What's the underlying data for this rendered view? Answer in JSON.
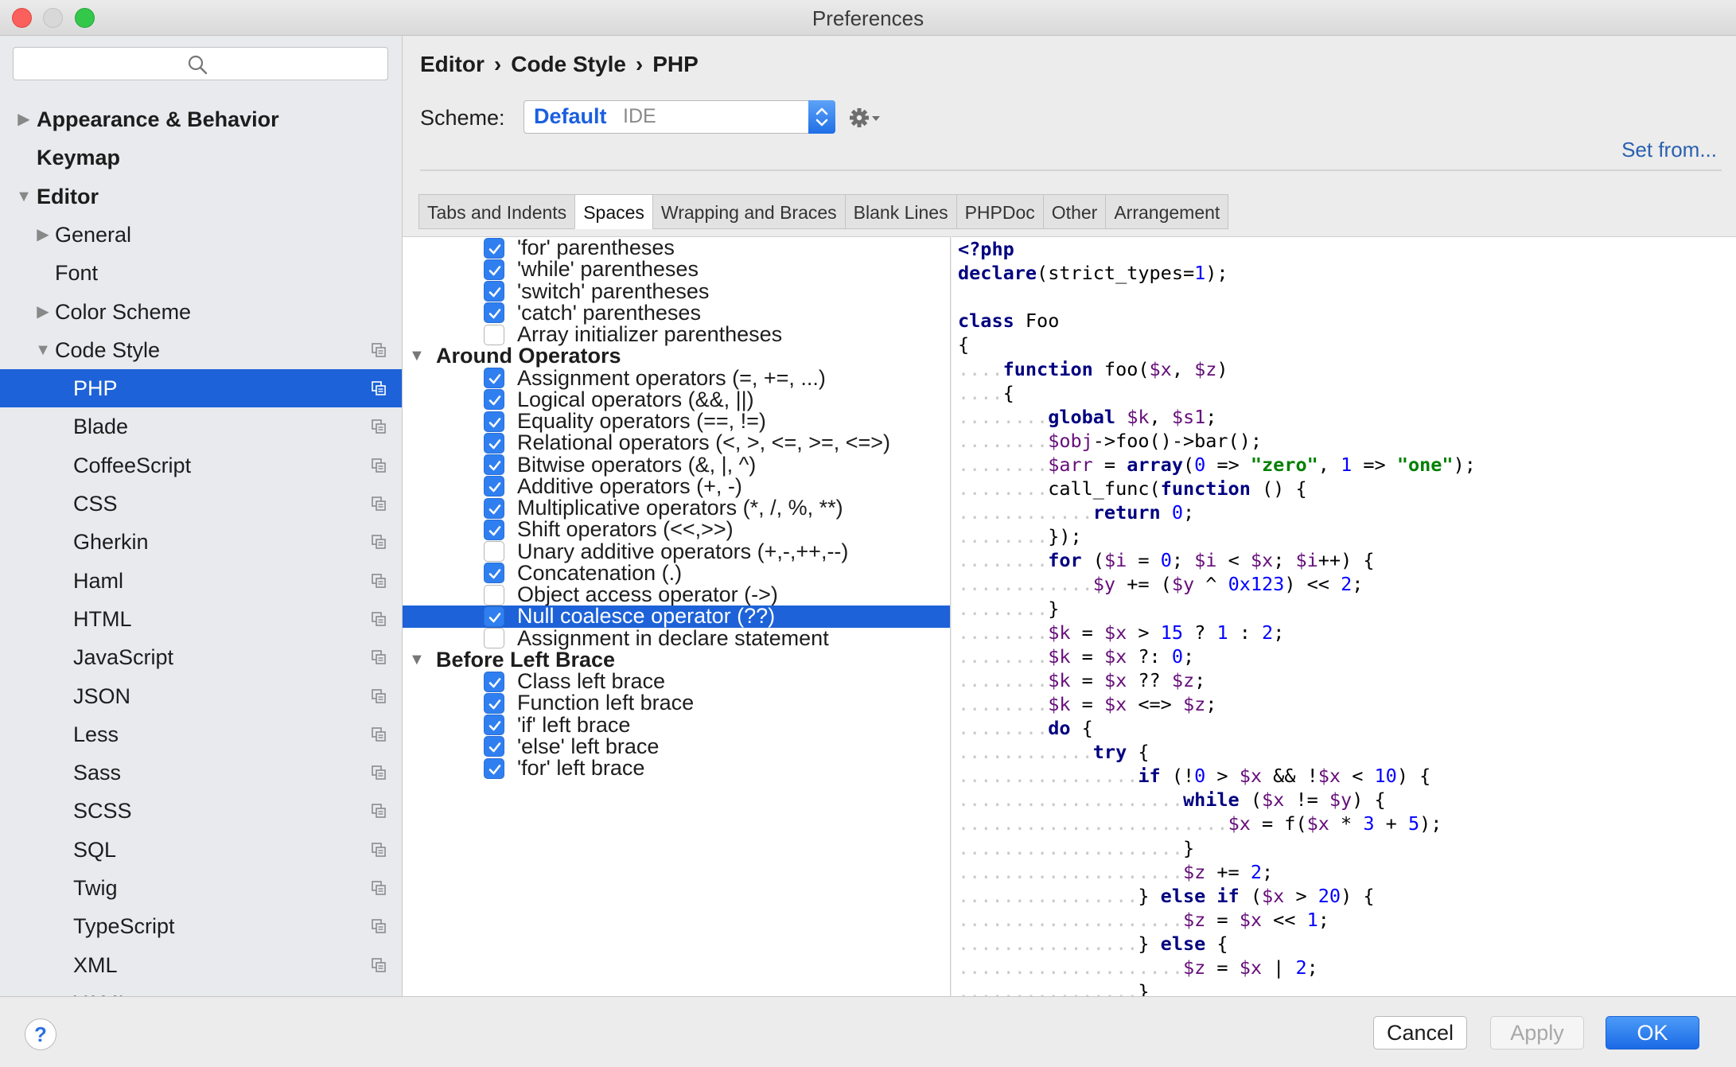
{
  "window": {
    "title": "Preferences"
  },
  "sidebar": {
    "search_placeholder": "",
    "items": [
      {
        "label": "Appearance & Behavior",
        "bold": true,
        "arrow": "right",
        "level": 0
      },
      {
        "label": "Keymap",
        "bold": true,
        "arrow": "",
        "level": 0
      },
      {
        "label": "Editor",
        "bold": true,
        "arrow": "down",
        "level": 0
      },
      {
        "label": "General",
        "bold": false,
        "arrow": "right",
        "level": 1
      },
      {
        "label": "Font",
        "bold": false,
        "arrow": "",
        "level": 1
      },
      {
        "label": "Color Scheme",
        "bold": false,
        "arrow": "right",
        "level": 1
      },
      {
        "label": "Code Style",
        "bold": false,
        "arrow": "down",
        "level": 1,
        "copy": true
      },
      {
        "label": "PHP",
        "bold": false,
        "arrow": "",
        "level": 2,
        "copy": true,
        "selected": true
      },
      {
        "label": "Blade",
        "level": 2,
        "copy": true
      },
      {
        "label": "CoffeeScript",
        "level": 2,
        "copy": true
      },
      {
        "label": "CSS",
        "level": 2,
        "copy": true
      },
      {
        "label": "Gherkin",
        "level": 2,
        "copy": true
      },
      {
        "label": "Haml",
        "level": 2,
        "copy": true
      },
      {
        "label": "HTML",
        "level": 2,
        "copy": true
      },
      {
        "label": "JavaScript",
        "level": 2,
        "copy": true
      },
      {
        "label": "JSON",
        "level": 2,
        "copy": true
      },
      {
        "label": "Less",
        "level": 2,
        "copy": true
      },
      {
        "label": "Sass",
        "level": 2,
        "copy": true
      },
      {
        "label": "SCSS",
        "level": 2,
        "copy": true
      },
      {
        "label": "SQL",
        "level": 2,
        "copy": true
      },
      {
        "label": "Twig",
        "level": 2,
        "copy": true
      },
      {
        "label": "TypeScript",
        "level": 2,
        "copy": true
      },
      {
        "label": "XML",
        "level": 2,
        "copy": true
      },
      {
        "label": "YAML",
        "level": 2,
        "copy": true
      }
    ]
  },
  "header": {
    "breadcrumb": [
      "Editor",
      "Code Style",
      "PHP"
    ],
    "breadcrumb_sep": "›",
    "scheme_label": "Scheme:",
    "scheme_name": "Default",
    "scheme_sub": "IDE",
    "set_from": "Set from..."
  },
  "tabs": [
    {
      "label": "Tabs and Indents",
      "active": false
    },
    {
      "label": "Spaces",
      "active": true
    },
    {
      "label": "Wrapping and Braces",
      "active": false
    },
    {
      "label": "Blank Lines",
      "active": false
    },
    {
      "label": "PHPDoc",
      "active": false
    },
    {
      "label": "Other",
      "active": false
    },
    {
      "label": "Arrangement",
      "active": false
    }
  ],
  "options": [
    {
      "type": "check",
      "label": "'for' parentheses",
      "checked": true
    },
    {
      "type": "check",
      "label": "'while' parentheses",
      "checked": true
    },
    {
      "type": "check",
      "label": "'switch' parentheses",
      "checked": true
    },
    {
      "type": "check",
      "label": "'catch' parentheses",
      "checked": true
    },
    {
      "type": "check",
      "label": "Array initializer parentheses",
      "checked": false
    },
    {
      "type": "group",
      "label": "Around Operators"
    },
    {
      "type": "check",
      "label": "Assignment operators (=, +=, ...)",
      "checked": true
    },
    {
      "type": "check",
      "label": "Logical operators (&&, ||)",
      "checked": true
    },
    {
      "type": "check",
      "label": "Equality operators (==, !=)",
      "checked": true
    },
    {
      "type": "check",
      "label": "Relational operators (<, >, <=, >=, <=>)",
      "checked": true
    },
    {
      "type": "check",
      "label": "Bitwise operators (&, |, ^)",
      "checked": true
    },
    {
      "type": "check",
      "label": "Additive operators (+, -)",
      "checked": true
    },
    {
      "type": "check",
      "label": "Multiplicative operators (*, /, %, **)",
      "checked": true
    },
    {
      "type": "check",
      "label": "Shift operators (<<,>>)",
      "checked": true
    },
    {
      "type": "check",
      "label": "Unary additive operators (+,-,++,--)",
      "checked": false
    },
    {
      "type": "check",
      "label": "Concatenation (.)",
      "checked": true
    },
    {
      "type": "check",
      "label": "Object access operator (->)",
      "checked": false
    },
    {
      "type": "check",
      "label": "Null coalesce operator (??)",
      "checked": true,
      "selected": true
    },
    {
      "type": "check",
      "label": "Assignment in declare statement",
      "checked": false
    },
    {
      "type": "group",
      "label": "Before Left Brace"
    },
    {
      "type": "check",
      "label": "Class left brace",
      "checked": true
    },
    {
      "type": "check",
      "label": "Function left brace",
      "checked": true
    },
    {
      "type": "check",
      "label": "'if' left brace",
      "checked": true
    },
    {
      "type": "check",
      "label": "'else' left brace",
      "checked": true
    },
    {
      "type": "check",
      "label": "'for' left brace",
      "checked": true
    }
  ],
  "code_lines": [
    {
      "indent": 0,
      "tokens": [
        [
          "kw",
          "<?php"
        ]
      ]
    },
    {
      "indent": 0,
      "tokens": [
        [
          "kw",
          "declare"
        ],
        [
          "p",
          "(strict_types="
        ],
        [
          "num",
          "1"
        ],
        [
          "p",
          ");"
        ]
      ]
    },
    {
      "indent": 0,
      "tokens": []
    },
    {
      "indent": 0,
      "tokens": [
        [
          "kw",
          "class"
        ],
        [
          "p",
          " Foo"
        ]
      ]
    },
    {
      "indent": 0,
      "tokens": [
        [
          "p",
          "{"
        ]
      ]
    },
    {
      "indent": 1,
      "tokens": [
        [
          "kw",
          "function"
        ],
        [
          "p",
          " foo("
        ],
        [
          "var",
          "$x"
        ],
        [
          "p",
          ", "
        ],
        [
          "var",
          "$z"
        ],
        [
          "p",
          ")"
        ]
      ]
    },
    {
      "indent": 1,
      "tokens": [
        [
          "p",
          "{"
        ]
      ]
    },
    {
      "indent": 2,
      "tokens": [
        [
          "kw",
          "global"
        ],
        [
          "p",
          " "
        ],
        [
          "var",
          "$k"
        ],
        [
          "p",
          ", "
        ],
        [
          "var",
          "$s1"
        ],
        [
          "p",
          ";"
        ]
      ]
    },
    {
      "indent": 2,
      "tokens": [
        [
          "var",
          "$obj"
        ],
        [
          "p",
          "->foo()->bar();"
        ]
      ]
    },
    {
      "indent": 2,
      "tokens": [
        [
          "var",
          "$arr"
        ],
        [
          "p",
          " = "
        ],
        [
          "kw",
          "array"
        ],
        [
          "p",
          "("
        ],
        [
          "num",
          "0"
        ],
        [
          "p",
          " => "
        ],
        [
          "str",
          "\"zero\""
        ],
        [
          "p",
          ", "
        ],
        [
          "num",
          "1"
        ],
        [
          "p",
          " => "
        ],
        [
          "str",
          "\"one\""
        ],
        [
          "p",
          ");"
        ]
      ]
    },
    {
      "indent": 2,
      "tokens": [
        [
          "p",
          "call_func("
        ],
        [
          "kw",
          "function"
        ],
        [
          "p",
          " () {"
        ]
      ]
    },
    {
      "indent": 3,
      "tokens": [
        [
          "kw",
          "return"
        ],
        [
          "p",
          " "
        ],
        [
          "num",
          "0"
        ],
        [
          "p",
          ";"
        ]
      ]
    },
    {
      "indent": 2,
      "tokens": [
        [
          "p",
          "});"
        ]
      ]
    },
    {
      "indent": 2,
      "tokens": [
        [
          "kw",
          "for"
        ],
        [
          "p",
          " ("
        ],
        [
          "var",
          "$i"
        ],
        [
          "p",
          " = "
        ],
        [
          "num",
          "0"
        ],
        [
          "p",
          "; "
        ],
        [
          "var",
          "$i"
        ],
        [
          "p",
          " < "
        ],
        [
          "var",
          "$x"
        ],
        [
          "p",
          "; "
        ],
        [
          "var",
          "$i"
        ],
        [
          "p",
          "++) {"
        ]
      ]
    },
    {
      "indent": 3,
      "tokens": [
        [
          "var",
          "$y"
        ],
        [
          "p",
          " += ("
        ],
        [
          "var",
          "$y"
        ],
        [
          "p",
          " ^ "
        ],
        [
          "num",
          "0x123"
        ],
        [
          "p",
          ") << "
        ],
        [
          "num",
          "2"
        ],
        [
          "p",
          ";"
        ]
      ]
    },
    {
      "indent": 2,
      "tokens": [
        [
          "p",
          "}"
        ]
      ]
    },
    {
      "indent": 2,
      "tokens": [
        [
          "var",
          "$k"
        ],
        [
          "p",
          " = "
        ],
        [
          "var",
          "$x"
        ],
        [
          "p",
          " > "
        ],
        [
          "num",
          "15"
        ],
        [
          "p",
          " ? "
        ],
        [
          "num",
          "1"
        ],
        [
          "p",
          " : "
        ],
        [
          "num",
          "2"
        ],
        [
          "p",
          ";"
        ]
      ]
    },
    {
      "indent": 2,
      "tokens": [
        [
          "var",
          "$k"
        ],
        [
          "p",
          " = "
        ],
        [
          "var",
          "$x"
        ],
        [
          "p",
          " ?: "
        ],
        [
          "num",
          "0"
        ],
        [
          "p",
          ";"
        ]
      ]
    },
    {
      "indent": 2,
      "tokens": [
        [
          "var",
          "$k"
        ],
        [
          "p",
          " = "
        ],
        [
          "var",
          "$x"
        ],
        [
          "p",
          " ?? "
        ],
        [
          "var",
          "$z"
        ],
        [
          "p",
          ";"
        ]
      ]
    },
    {
      "indent": 2,
      "tokens": [
        [
          "var",
          "$k"
        ],
        [
          "p",
          " = "
        ],
        [
          "var",
          "$x"
        ],
        [
          "p",
          " <=> "
        ],
        [
          "var",
          "$z"
        ],
        [
          "p",
          ";"
        ]
      ]
    },
    {
      "indent": 2,
      "tokens": [
        [
          "kw",
          "do"
        ],
        [
          "p",
          " {"
        ]
      ]
    },
    {
      "indent": 3,
      "tokens": [
        [
          "kw",
          "try"
        ],
        [
          "p",
          " {"
        ]
      ]
    },
    {
      "indent": 4,
      "tokens": [
        [
          "kw",
          "if"
        ],
        [
          "p",
          " (!"
        ],
        [
          "num",
          "0"
        ],
        [
          "p",
          " > "
        ],
        [
          "var",
          "$x"
        ],
        [
          "p",
          " && !"
        ],
        [
          "var",
          "$x"
        ],
        [
          "p",
          " < "
        ],
        [
          "num",
          "10"
        ],
        [
          "p",
          ") {"
        ]
      ]
    },
    {
      "indent": 5,
      "tokens": [
        [
          "kw",
          "while"
        ],
        [
          "p",
          " ("
        ],
        [
          "var",
          "$x"
        ],
        [
          "p",
          " != "
        ],
        [
          "var",
          "$y"
        ],
        [
          "p",
          ") {"
        ]
      ]
    },
    {
      "indent": 6,
      "tokens": [
        [
          "var",
          "$x"
        ],
        [
          "p",
          " = f("
        ],
        [
          "var",
          "$x"
        ],
        [
          "p",
          " * "
        ],
        [
          "num",
          "3"
        ],
        [
          "p",
          " + "
        ],
        [
          "num",
          "5"
        ],
        [
          "p",
          ");"
        ]
      ]
    },
    {
      "indent": 5,
      "tokens": [
        [
          "p",
          "}"
        ]
      ]
    },
    {
      "indent": 5,
      "tokens": [
        [
          "var",
          "$z"
        ],
        [
          "p",
          " += "
        ],
        [
          "num",
          "2"
        ],
        [
          "p",
          ";"
        ]
      ]
    },
    {
      "indent": 4,
      "tokens": [
        [
          "p",
          "} "
        ],
        [
          "kw",
          "else if"
        ],
        [
          "p",
          " ("
        ],
        [
          "var",
          "$x"
        ],
        [
          "p",
          " > "
        ],
        [
          "num",
          "20"
        ],
        [
          "p",
          ") {"
        ]
      ]
    },
    {
      "indent": 5,
      "tokens": [
        [
          "var",
          "$z"
        ],
        [
          "p",
          " = "
        ],
        [
          "var",
          "$x"
        ],
        [
          "p",
          " << "
        ],
        [
          "num",
          "1"
        ],
        [
          "p",
          ";"
        ]
      ]
    },
    {
      "indent": 4,
      "tokens": [
        [
          "p",
          "} "
        ],
        [
          "kw",
          "else"
        ],
        [
          "p",
          " {"
        ]
      ]
    },
    {
      "indent": 5,
      "tokens": [
        [
          "var",
          "$z"
        ],
        [
          "p",
          " = "
        ],
        [
          "var",
          "$x"
        ],
        [
          "p",
          " | "
        ],
        [
          "num",
          "2"
        ],
        [
          "p",
          ";"
        ]
      ]
    },
    {
      "indent": 4,
      "tokens": [
        [
          "p",
          "}"
        ]
      ]
    }
  ],
  "footer": {
    "help_label": "?",
    "cancel_label": "Cancel",
    "apply_label": "Apply",
    "ok_label": "OK"
  },
  "colors": {
    "selection": "#1d62d8",
    "checkbox_on": "#2f7ff0",
    "keyword": "#000080",
    "variable": "#660e7a",
    "number": "#0000ff",
    "string": "#008000",
    "link": "#2a60b0"
  }
}
